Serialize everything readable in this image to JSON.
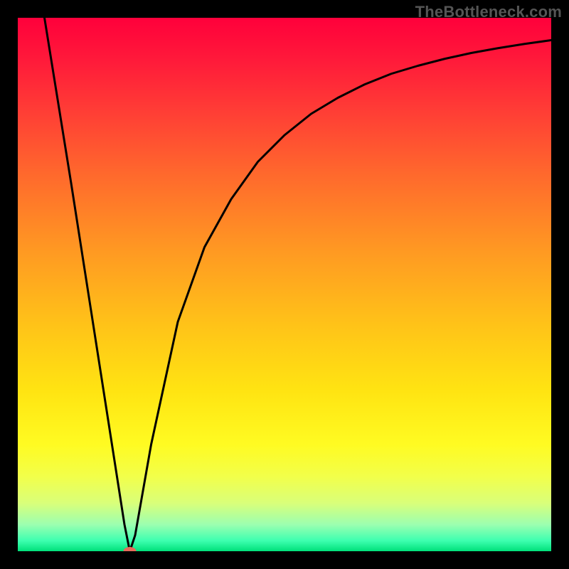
{
  "attribution": "TheBottleneck.com",
  "colors": {
    "frame": "#000000",
    "curve_stroke": "#000000",
    "marker_fill": "#e86a5a",
    "gradient_top": "#ff003b",
    "gradient_bottom": "#00e07a"
  },
  "chart_data": {
    "type": "line",
    "title": "",
    "xlabel": "",
    "ylabel": "",
    "xlim": [
      0,
      100
    ],
    "ylim": [
      0,
      100
    ],
    "grid": false,
    "legend": false,
    "series": [
      {
        "name": "bottleneck-curve",
        "x": [
          5,
          10,
          15,
          20,
          21,
          22,
          25,
          30,
          35,
          40,
          45,
          50,
          55,
          60,
          65,
          70,
          75,
          80,
          85,
          90,
          95,
          100
        ],
        "y": [
          100,
          69,
          37,
          5,
          0,
          3,
          20,
          43,
          57,
          66,
          73,
          78,
          82,
          85,
          87.5,
          89.5,
          91,
          92.3,
          93.4,
          94.3,
          95.1,
          95.8
        ]
      }
    ],
    "markers": [
      {
        "name": "optimal-point",
        "x": 21,
        "y": 0
      }
    ],
    "annotations": []
  }
}
